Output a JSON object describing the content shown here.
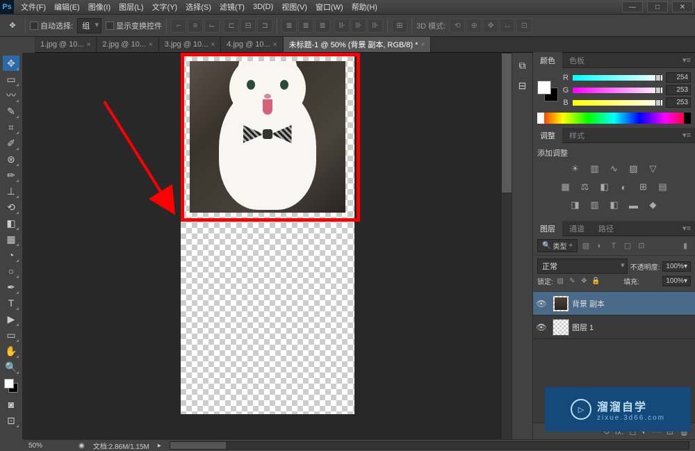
{
  "app": {
    "logo": "Ps"
  },
  "menu": [
    "文件(F)",
    "编辑(E)",
    "图像(I)",
    "图层(L)",
    "文字(Y)",
    "选择(S)",
    "滤镜(T)",
    "3D(D)",
    "视图(V)",
    "窗口(W)",
    "帮助(H)"
  ],
  "optbar": {
    "auto_select": "自动选择:",
    "group": "组",
    "show_transform": "显示变换控件",
    "mode3d": "3D 模式:"
  },
  "tabs": [
    {
      "label": "1.jpg @ 10...",
      "active": false
    },
    {
      "label": "2.jpg @ 10...",
      "active": false
    },
    {
      "label": "3.jpg @ 10...",
      "active": false
    },
    {
      "label": "4.jpg @ 10...",
      "active": false
    },
    {
      "label": "未标题-1 @ 50% (背景 副本, RGB/8) *",
      "active": true
    }
  ],
  "panels": {
    "color": {
      "tabs": [
        "颜色",
        "色板"
      ],
      "r": {
        "label": "R",
        "value": "254"
      },
      "g": {
        "label": "G",
        "value": "253"
      },
      "b": {
        "label": "B",
        "value": "253"
      }
    },
    "adjust": {
      "tabs": [
        "调整",
        "样式"
      ],
      "title": "添加调整"
    },
    "layers": {
      "tabs": [
        "图层",
        "通道",
        "路径"
      ],
      "kind": "类型",
      "blend": "正常",
      "opacity_label": "不透明度:",
      "opacity_value": "100%",
      "lock_label": "锁定:",
      "fill_label": "填充:",
      "fill_value": "100%",
      "items": [
        {
          "name": "背景 副本",
          "selected": true,
          "hascat": true
        },
        {
          "name": "图层 1",
          "selected": false,
          "hascat": false
        }
      ]
    }
  },
  "status": {
    "zoom": "50%",
    "doc": "文档:2.86M/1.15M"
  },
  "watermark": {
    "main": "溜溜自学",
    "sub": "zixue.3d66.com"
  }
}
